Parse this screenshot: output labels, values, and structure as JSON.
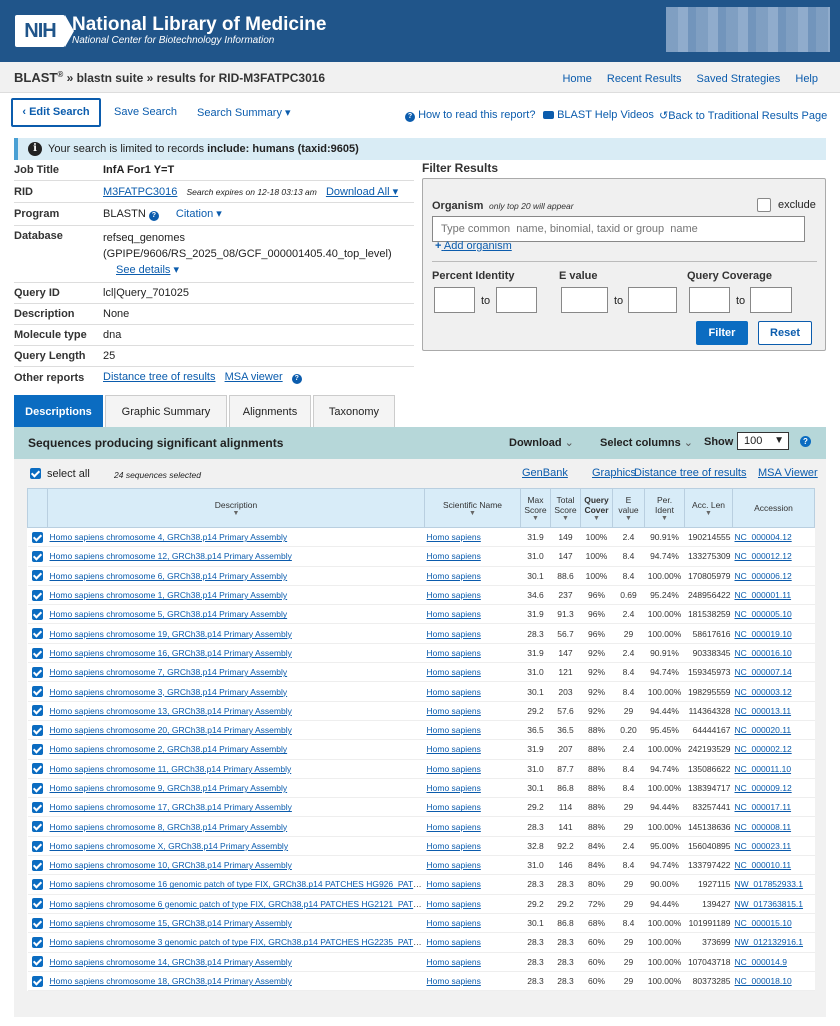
{
  "header": {
    "logo": "NIH",
    "title": "National Library of Medicine",
    "subtitle": "National Center for Biotechnology Information"
  },
  "breadcrumb": {
    "blast": "BLAST",
    "reg": "®",
    "rest": " » blastn suite » results for RID-M3FATPC3016"
  },
  "topnav": [
    "Home",
    "Recent Results",
    "Saved Strategies",
    "Help"
  ],
  "toolbar": {
    "edit_search": "Edit Search",
    "save_search": "Save Search",
    "search_summary": "Search Summary",
    "how_to_read": "How to read this report?",
    "help_videos": "BLAST Help Videos",
    "back_traditional": "Back to Traditional Results Page"
  },
  "notice": {
    "prefix": "Your search is limited to records ",
    "bold": "include: humans (taxid:9605)"
  },
  "job": {
    "title_key": "Job Title",
    "title_val": "InfA For1 Y=T",
    "rid_key": "RID",
    "rid_val": "M3FATPC3016",
    "rid_expires": "Search expires on 12-18 03:13 am",
    "download_all": "Download All",
    "program_key": "Program",
    "program_val": "BLASTN",
    "citation": "Citation",
    "database_key": "Database",
    "database_val1": "refseq_genomes",
    "database_val2": "(GPIPE/9606/RS_2025_08/GCF_000001405.40_top_level)",
    "see_details": "See details",
    "queryid_key": "Query ID",
    "queryid_val": "lcl|Query_701025",
    "desc_key": "Description",
    "desc_val": "None",
    "moltype_key": "Molecule type",
    "moltype_val": "dna",
    "qlen_key": "Query Length",
    "qlen_val": "25",
    "other_key": "Other reports",
    "other_tree": "Distance tree of results",
    "other_msa": "MSA viewer"
  },
  "filter": {
    "title": "Filter Results",
    "organism_label": "Organism",
    "organism_hint": "only top 20 will appear",
    "exclude": "exclude",
    "organism_placeholder": "Type common  name, binomial, taxid or group  name",
    "add_organism": "Add organism",
    "percent_identity": "Percent Identity",
    "e_value": "E value",
    "query_coverage": "Query Coverage",
    "to": "to",
    "filter_btn": "Filter",
    "reset_btn": "Reset"
  },
  "tabs": [
    "Descriptions",
    "Graphic Summary",
    "Alignments",
    "Taxonomy"
  ],
  "results": {
    "title": "Sequences producing significant alignments",
    "download": "Download",
    "select_columns": "Select columns",
    "show": "Show",
    "show_value": "100",
    "select_all": "select all",
    "selected_count": "24 sequences selected",
    "links": [
      "GenBank",
      "Graphics",
      "Distance tree of results",
      "MSA Viewer"
    ],
    "columns": [
      "Description",
      "Scientific Name",
      "Max Score",
      "Total Score",
      "Query Cover",
      "E value",
      "Per. Ident",
      "Acc. Len",
      "Accession"
    ],
    "rows": [
      [
        "Homo sapiens chromosome 4, GRCh38.p14 Primary Assembly",
        "Homo sapiens",
        "31.9",
        "149",
        "100%",
        "2.4",
        "90.91%",
        "190214555",
        "NC_000004.12"
      ],
      [
        "Homo sapiens chromosome 12, GRCh38.p14 Primary Assembly",
        "Homo sapiens",
        "31.0",
        "147",
        "100%",
        "8.4",
        "94.74%",
        "133275309",
        "NC_000012.12"
      ],
      [
        "Homo sapiens chromosome 6, GRCh38.p14 Primary Assembly",
        "Homo sapiens",
        "30.1",
        "88.6",
        "100%",
        "8.4",
        "100.00%",
        "170805979",
        "NC_000006.12"
      ],
      [
        "Homo sapiens chromosome 1, GRCh38.p14 Primary Assembly",
        "Homo sapiens",
        "34.6",
        "237",
        "96%",
        "0.69",
        "95.24%",
        "248956422",
        "NC_000001.11"
      ],
      [
        "Homo sapiens chromosome 5, GRCh38.p14 Primary Assembly",
        "Homo sapiens",
        "31.9",
        "91.3",
        "96%",
        "2.4",
        "100.00%",
        "181538259",
        "NC_000005.10"
      ],
      [
        "Homo sapiens chromosome 19, GRCh38.p14 Primary Assembly",
        "Homo sapiens",
        "28.3",
        "56.7",
        "96%",
        "29",
        "100.00%",
        "58617616",
        "NC_000019.10"
      ],
      [
        "Homo sapiens chromosome 16, GRCh38.p14 Primary Assembly",
        "Homo sapiens",
        "31.9",
        "147",
        "92%",
        "2.4",
        "90.91%",
        "90338345",
        "NC_000016.10"
      ],
      [
        "Homo sapiens chromosome 7, GRCh38.p14 Primary Assembly",
        "Homo sapiens",
        "31.0",
        "121",
        "92%",
        "8.4",
        "94.74%",
        "159345973",
        "NC_000007.14"
      ],
      [
        "Homo sapiens chromosome 3, GRCh38.p14 Primary Assembly",
        "Homo sapiens",
        "30.1",
        "203",
        "92%",
        "8.4",
        "100.00%",
        "198295559",
        "NC_000003.12"
      ],
      [
        "Homo sapiens chromosome 13, GRCh38.p14 Primary Assembly",
        "Homo sapiens",
        "29.2",
        "57.6",
        "92%",
        "29",
        "94.44%",
        "114364328",
        "NC_000013.11"
      ],
      [
        "Homo sapiens chromosome 20, GRCh38.p14 Primary Assembly",
        "Homo sapiens",
        "36.5",
        "36.5",
        "88%",
        "0.20",
        "95.45%",
        "64444167",
        "NC_000020.11"
      ],
      [
        "Homo sapiens chromosome 2, GRCh38.p14 Primary Assembly",
        "Homo sapiens",
        "31.9",
        "207",
        "88%",
        "2.4",
        "100.00%",
        "242193529",
        "NC_000002.12"
      ],
      [
        "Homo sapiens chromosome 11, GRCh38.p14 Primary Assembly",
        "Homo sapiens",
        "31.0",
        "87.7",
        "88%",
        "8.4",
        "94.74%",
        "135086622",
        "NC_000011.10"
      ],
      [
        "Homo sapiens chromosome 9, GRCh38.p14 Primary Assembly",
        "Homo sapiens",
        "30.1",
        "86.8",
        "88%",
        "8.4",
        "100.00%",
        "138394717",
        "NC_000009.12"
      ],
      [
        "Homo sapiens chromosome 17, GRCh38.p14 Primary Assembly",
        "Homo sapiens",
        "29.2",
        "114",
        "88%",
        "29",
        "94.44%",
        "83257441",
        "NC_000017.11"
      ],
      [
        "Homo sapiens chromosome 8, GRCh38.p14 Primary Assembly",
        "Homo sapiens",
        "28.3",
        "141",
        "88%",
        "29",
        "100.00%",
        "145138636",
        "NC_000008.11"
      ],
      [
        "Homo sapiens chromosome X, GRCh38.p14 Primary Assembly",
        "Homo sapiens",
        "32.8",
        "92.2",
        "84%",
        "2.4",
        "95.00%",
        "156040895",
        "NC_000023.11"
      ],
      [
        "Homo sapiens chromosome 10, GRCh38.p14 Primary Assembly",
        "Homo sapiens",
        "31.0",
        "146",
        "84%",
        "8.4",
        "94.74%",
        "133797422",
        "NC_000010.11"
      ],
      [
        "Homo sapiens chromosome 16 genomic patch of type FIX, GRCh38.p14 PATCHES HG926_PATCH",
        "Homo sapiens",
        "28.3",
        "28.3",
        "80%",
        "29",
        "90.00%",
        "1927115",
        "NW_017852933.1"
      ],
      [
        "Homo sapiens chromosome 6 genomic patch of type FIX, GRCh38.p14 PATCHES HG2121_PATCH",
        "Homo sapiens",
        "29.2",
        "29.2",
        "72%",
        "29",
        "94.44%",
        "139427",
        "NW_017363815.1"
      ],
      [
        "Homo sapiens chromosome 15, GRCh38.p14 Primary Assembly",
        "Homo sapiens",
        "30.1",
        "86.8",
        "68%",
        "8.4",
        "100.00%",
        "101991189",
        "NC_000015.10"
      ],
      [
        "Homo sapiens chromosome 3 genomic patch of type FIX, GRCh38.p14 PATCHES HG2235_PATCH",
        "Homo sapiens",
        "28.3",
        "28.3",
        "60%",
        "29",
        "100.00%",
        "373699",
        "NW_012132916.1"
      ],
      [
        "Homo sapiens chromosome 14, GRCh38.p14 Primary Assembly",
        "Homo sapiens",
        "28.3",
        "28.3",
        "60%",
        "29",
        "100.00%",
        "107043718",
        "NC_000014.9"
      ],
      [
        "Homo sapiens chromosome 18, GRCh38.p14 Primary Assembly",
        "Homo sapiens",
        "28.3",
        "28.3",
        "60%",
        "29",
        "100.00%",
        "80373285",
        "NC_000018.10"
      ]
    ]
  }
}
